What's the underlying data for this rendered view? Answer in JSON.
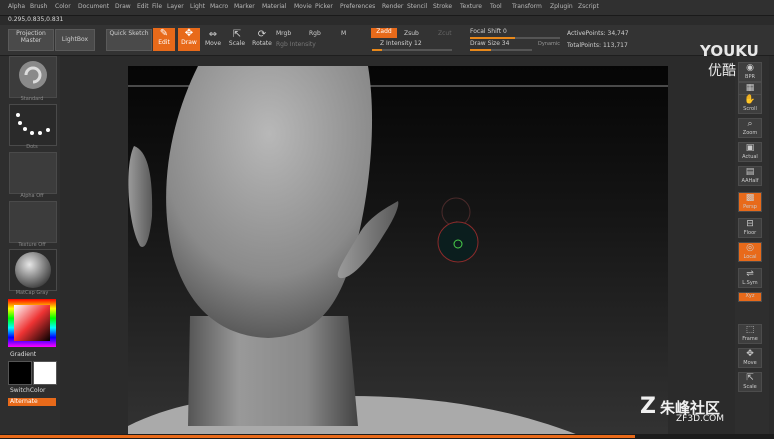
{
  "menu": [
    "Alpha",
    "Brush",
    "Color",
    "Document",
    "Draw",
    "Edit",
    "File",
    "Layer",
    "Light",
    "Macro",
    "Marker",
    "Material",
    "Movie",
    "Picker",
    "Preferences",
    "Render",
    "Stencil",
    "Stroke",
    "Texture",
    "Tool",
    "Transform",
    "Zplugin",
    "Zscript"
  ],
  "coords": "0.295,0.835,0.831",
  "toolbar": {
    "projection_master": "Projection Master",
    "lightbox": "LightBox",
    "quick_sketch": "Quick Sketch",
    "edit": "Edit",
    "draw": "Draw",
    "move": "Move",
    "scale": "Scale",
    "rotate": "Rotate",
    "mrgb": "Mrgb",
    "rgb": "Rgb",
    "m": "M",
    "rgb_intensity": "Rgb Intensity",
    "zadd": "Zadd",
    "zsub": "Zsub",
    "zcut": "Zcut",
    "z_intensity": "Z Intensity 12",
    "focal_shift": "Focal Shift 0",
    "draw_size": "Draw Size 34",
    "dynamic": "Dynamic",
    "active_points": "ActivePoints: 34,747",
    "total_points": "TotalPoints: 113,717"
  },
  "sliders": {
    "z_intensity": 0.12,
    "focal_shift": 0.5,
    "draw_size": 0.34
  },
  "left": {
    "standard": "Standard",
    "dots": "Dots",
    "alpha_off": "Alpha Off",
    "texture_off": "Texture Off",
    "matcap": "MatCap Gray",
    "gradient": "Gradient",
    "switch_color": "SwitchColor",
    "alternate": "Alternate"
  },
  "right": [
    "BPR",
    "Spix",
    "Scroll",
    "Zoom",
    "Actual",
    "AAHalf",
    "Persp",
    "Floor",
    "Local",
    "L.Sym",
    "Xyz",
    "Frame",
    "Move",
    "Scale"
  ],
  "logo": "YOUKU",
  "logo_cn": "优酷",
  "watermark": "朱峰社区",
  "watermark_url": "ZF3D.COM",
  "timeline_progress": 0.82,
  "colors": {
    "accent": "#e86a1a"
  }
}
